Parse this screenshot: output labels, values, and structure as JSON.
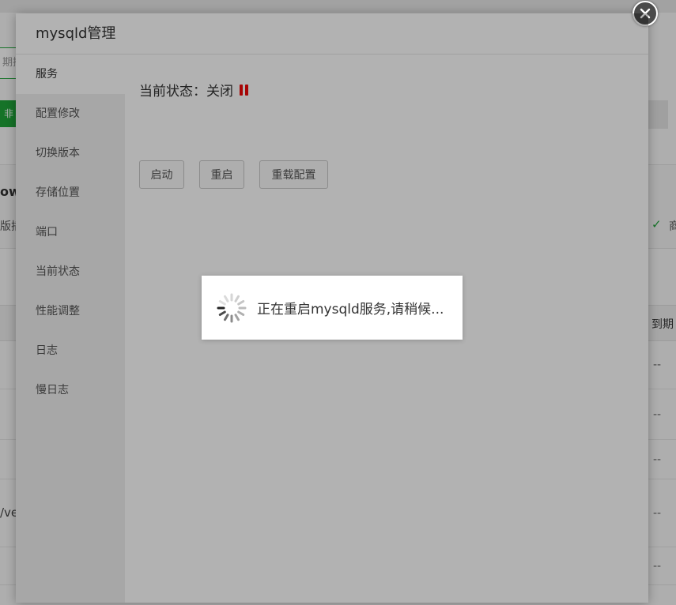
{
  "background": {
    "search_placeholder": "期搜",
    "green_button": "非",
    "ow": "ow",
    "ban": "版插",
    "check_text": "商",
    "expire_header": "到期",
    "dash": "--",
    "ve": "/ve"
  },
  "modal": {
    "title": "mysqld管理",
    "sidebar": {
      "items": [
        {
          "label": "服务",
          "active": true
        },
        {
          "label": "配置修改"
        },
        {
          "label": "切换版本"
        },
        {
          "label": "存储位置"
        },
        {
          "label": "端口"
        },
        {
          "label": "当前状态"
        },
        {
          "label": "性能调整"
        },
        {
          "label": "日志"
        },
        {
          "label": "慢日志"
        }
      ]
    },
    "service": {
      "status_label": "当前状态：关闭",
      "status_color": "#ef0808",
      "buttons": {
        "start": "启动",
        "restart": "重启",
        "reload": "重载配置"
      }
    }
  },
  "loading": {
    "message": "正在重启mysqld服务,请稍候..."
  },
  "icons": {
    "close": "close-icon",
    "status": "pause-icon",
    "spinner": "loading-spinner-icon"
  }
}
